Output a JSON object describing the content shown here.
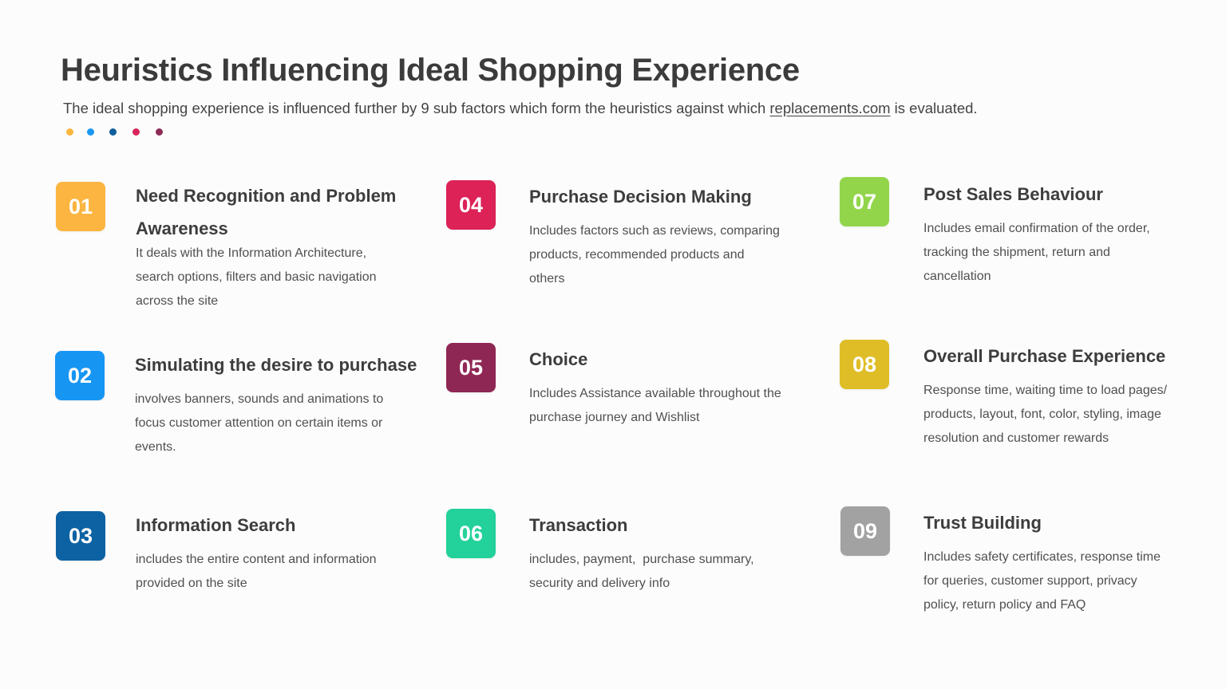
{
  "header": {
    "title": "Heuristics Influencing Ideal Shopping Experience",
    "subtitle_before": "The ideal shopping experience is influenced further by 9 sub factors which form the heuristics against which ",
    "subtitle_link": "replacements.com",
    "subtitle_after": " is evaluated.",
    "dots": [
      {
        "color": "#f9b73f"
      },
      {
        "color": "#1a97f0"
      },
      {
        "color": "#0e5f9b"
      },
      {
        "color": "#d9245b"
      },
      {
        "color": "#8e2a56"
      }
    ]
  },
  "items": [
    {
      "number": "01",
      "color": "#fbb540",
      "title_line1": "Need Recognition and Problem",
      "title_line2": "Awareness",
      "description_lines": [
        "It deals with the Information Architecture,",
        "search options, filters and basic navigation",
        "across the site"
      ]
    },
    {
      "number": "02",
      "color": "#1795f3",
      "title_line1": "Simulating the desire to purchase",
      "description_lines": [
        "involves banners, sounds and animations to",
        "focus customer attention on certain items or",
        "events."
      ]
    },
    {
      "number": "03",
      "color": "#0d62a3",
      "title_line1": "Information Search",
      "description_lines": [
        "includes the entire content and information",
        "provided on the site"
      ]
    },
    {
      "number": "04",
      "color": "#dc2257",
      "title_line1": "Purchase Decision Making",
      "description_lines": [
        "Includes factors such as reviews, comparing",
        "products, recommended products and",
        "others"
      ]
    },
    {
      "number": "05",
      "color": "#8f2754",
      "title_line1": "Choice",
      "description_lines": [
        "Includes Assistance available throughout the",
        "purchase journey and Wishlist"
      ]
    },
    {
      "number": "06",
      "color": "#23d19a",
      "title_line1": "Transaction",
      "description_lines": [
        "includes, payment,  purchase summary,",
        "security and delivery info"
      ]
    },
    {
      "number": "07",
      "color": "#92d54b",
      "title_line1": "Post Sales Behaviour",
      "description_lines": [
        "Includes email confirmation of the order,",
        "tracking the shipment, return and",
        "cancellation"
      ]
    },
    {
      "number": "08",
      "color": "#dfbd27",
      "title_line1": "Overall Purchase Experience",
      "description_lines": [
        "Response time, waiting time to load pages/",
        "products, layout, font, color, styling, image",
        "resolution and customer rewards"
      ]
    },
    {
      "number": "09",
      "color": "#a2a2a2",
      "title_line1": "Trust Building",
      "description_lines": [
        "Includes safety certificates, response time",
        "for queries, customer support, privacy",
        "policy, return policy and FAQ"
      ]
    }
  ]
}
